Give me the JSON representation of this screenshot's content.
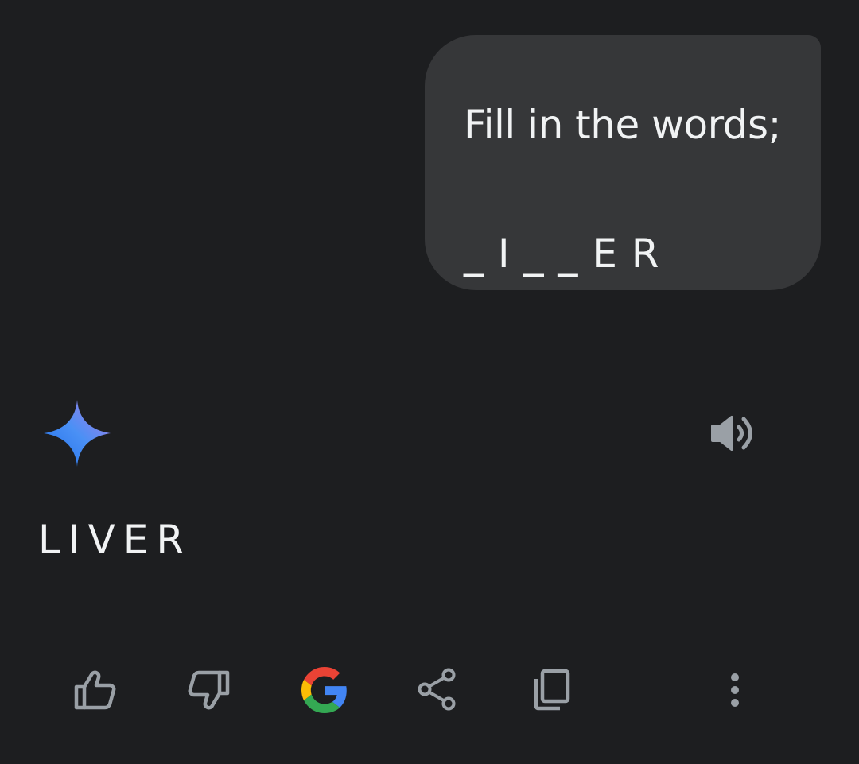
{
  "user_message": {
    "line1": "Fill in the words;",
    "line2": "_ I _ _ E R"
  },
  "response": {
    "icon": "gemini-sparkle-icon",
    "text": "LIVER",
    "speaker_icon": "volume-icon"
  },
  "actions": [
    {
      "name": "thumbs-up",
      "icon": "thumbs-up-icon"
    },
    {
      "name": "thumbs-down",
      "icon": "thumbs-down-icon"
    },
    {
      "name": "google-search",
      "icon": "google-g-icon"
    },
    {
      "name": "share",
      "icon": "share-icon"
    },
    {
      "name": "copy",
      "icon": "copy-icon"
    },
    {
      "name": "more",
      "icon": "more-vert-icon"
    }
  ],
  "colors": {
    "background": "#1d1e20",
    "bubble": "#363739",
    "text": "#f1f3f4",
    "icon_gray": "#9aa0a6",
    "sparkle_start": "#4285f4",
    "sparkle_end": "#9b72cb"
  }
}
